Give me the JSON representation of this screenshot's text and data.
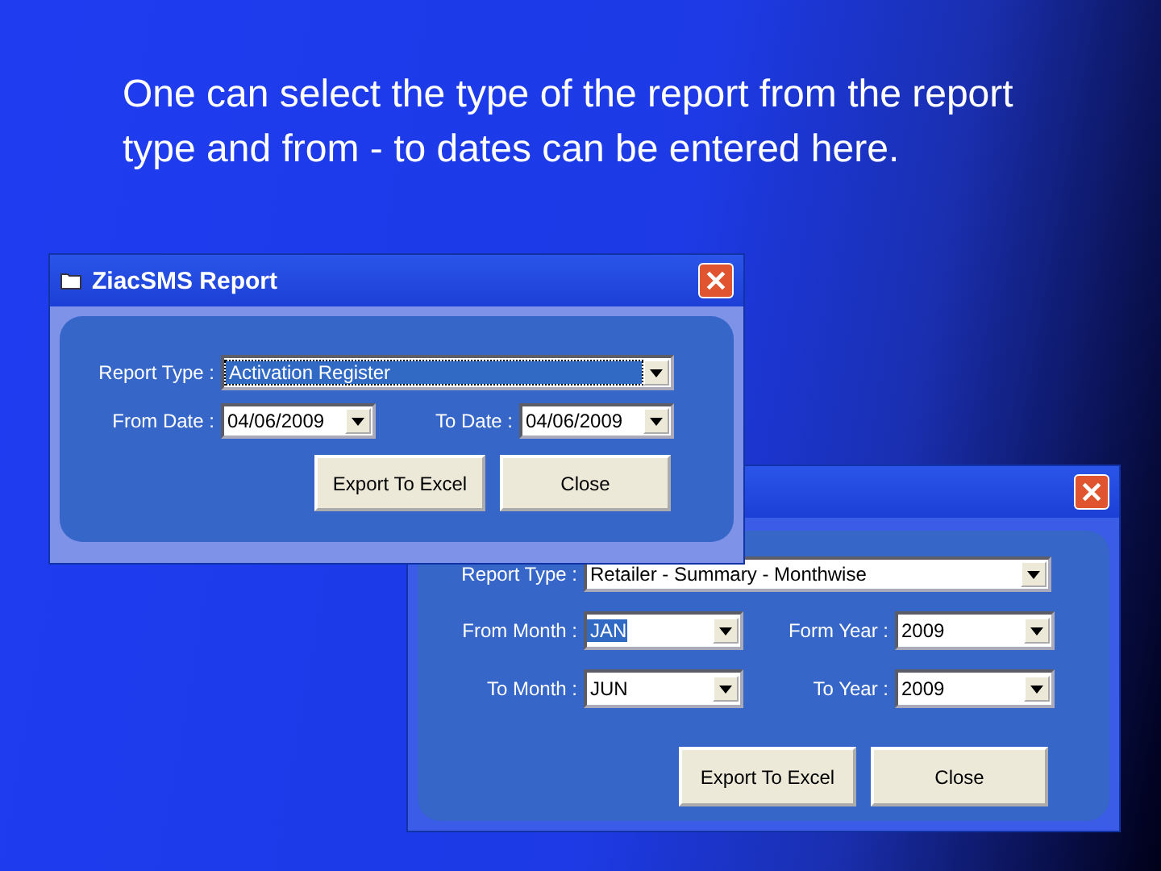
{
  "caption": "One can select the type of the report from the report type and from - to dates can be entered here.",
  "windows": [
    {
      "title": "ZiacSMS Report",
      "rows": [
        [
          {
            "label": "Report Type :",
            "value": "Activation Register",
            "focused": true,
            "highlighted": false
          }
        ],
        [
          {
            "label": "From Date :",
            "value": "04/06/2009",
            "focused": false,
            "highlighted": false
          },
          {
            "label": "To Date :",
            "value": "04/06/2009",
            "focused": false,
            "highlighted": false
          }
        ]
      ],
      "buttons": [
        "Export To Excel",
        "Close"
      ]
    },
    {
      "rows": [
        [
          {
            "label": "Report Type :",
            "value": "Retailer - Summary - Monthwise",
            "focused": false,
            "highlighted": false
          }
        ],
        [
          {
            "label": "From Month :",
            "value": "JAN",
            "focused": false,
            "highlighted": true
          },
          {
            "label": "Form Year :",
            "value": "2009",
            "focused": false,
            "highlighted": false
          }
        ],
        [
          {
            "label": "To Month :",
            "value": "JUN",
            "focused": false,
            "highlighted": false
          },
          {
            "label": "To Year :",
            "value": "2009",
            "focused": false,
            "highlighted": false
          }
        ]
      ],
      "buttons": [
        "Export To Excel",
        "Close"
      ]
    }
  ]
}
